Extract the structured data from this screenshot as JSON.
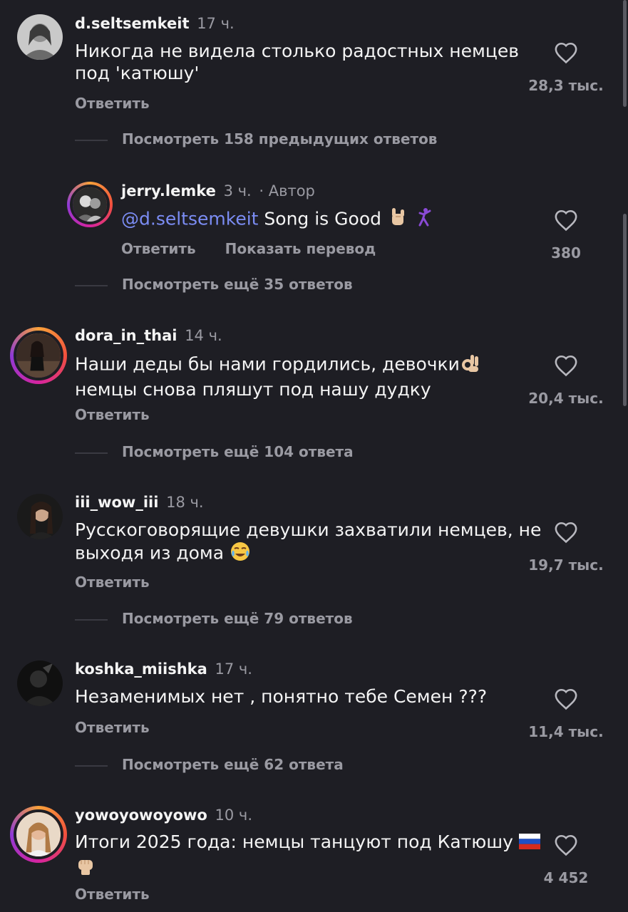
{
  "comments": [
    {
      "username": "d.seltsemkeit",
      "time": "17 ч.",
      "text": "Никогда не видела столько радостных немцев под 'катюшу'",
      "reply_label": "Ответить",
      "likes": "28,3 тыс.",
      "thread_label": "Посмотреть 158 предыдущих ответов"
    },
    {
      "username": "jerry.lemke",
      "time": "3 ч.",
      "author_tag": "· Автор",
      "mention": "@d.seltsemkeit",
      "text": "Song is Good",
      "reply_label": "Ответить",
      "translate_label": "Показать перевод",
      "likes": "380",
      "thread_label": "Посмотреть ещё 35 ответов"
    },
    {
      "username": "dora_in_thai",
      "time": "14 ч.",
      "text_a": "Наши деды бы нами гордились, девочки",
      "text_b": " немцы снова пляшут под нашу дудку",
      "reply_label": "Ответить",
      "likes": "20,4 тыс.",
      "thread_label": "Посмотреть ещё 104 ответа"
    },
    {
      "username": "iii_wow_iii",
      "time": "18 ч.",
      "text": "Русскоговорящие девушки захватили немцев, не выходя из дома",
      "reply_label": "Ответить",
      "likes": "19,7 тыс.",
      "thread_label": "Посмотреть ещё 79 ответов"
    },
    {
      "username": "koshka_miishka",
      "time": "17 ч.",
      "text": "Незаменимых нет , понятно тебе Семен ???",
      "reply_label": "Ответить",
      "likes": "11,4 тыс.",
      "thread_label": "Посмотреть ещё 62 ответа"
    },
    {
      "username": "yowoyowoyowo",
      "time": "10 ч.",
      "text": "Итоги 2025 года: немцы танцуют под Катюшу",
      "reply_label": "Ответить",
      "likes": "4 452"
    }
  ],
  "icons": {
    "like": "heart-outline-icon",
    "emoji_rock": "sign-of-horns-emoji",
    "emoji_dancer": "man-dancing-emoji",
    "emoji_ok": "ok-hand-emoji",
    "emoji_laugh": "face-with-tears-of-joy-emoji",
    "emoji_flag": "russia-flag-emoji",
    "emoji_fist": "raised-fist-emoji"
  },
  "colors": {
    "background": "#1e1e24",
    "mention": "#7b8cf3",
    "secondary_text": "#9a9aa2"
  }
}
